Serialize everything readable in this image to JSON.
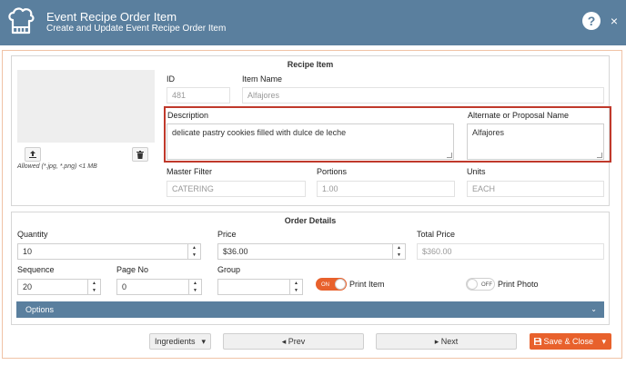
{
  "header": {
    "title": "Event Recipe Order Item",
    "subtitle": "Create and Update Event Recipe Order Item",
    "help_label": "?",
    "close_label": "×",
    "icon": "chef-hat-icon"
  },
  "recipe_item": {
    "section_title": "Recipe Item",
    "upload_icon": "upload-icon",
    "delete_icon": "trash-icon",
    "allowed_note": "Allowed (*.jpg, *.png) <1 MB",
    "id": {
      "label": "ID",
      "value": "481"
    },
    "item_name": {
      "label": "Item Name",
      "value": "Alfajores"
    },
    "description": {
      "label": "Description",
      "value": "delicate pastry cookies filled with dulce de leche"
    },
    "alternate_name": {
      "label": "Alternate or Proposal Name",
      "value": "Alfajores"
    },
    "master_filter": {
      "label": "Master Filter",
      "value": "CATERING"
    },
    "portions": {
      "label": "Portions",
      "value": "1.00"
    },
    "units": {
      "label": "Units",
      "value": "EACH"
    }
  },
  "order_details": {
    "section_title": "Order Details",
    "quantity": {
      "label": "Quantity",
      "value": "10"
    },
    "price": {
      "label": "Price",
      "value": "$36.00"
    },
    "total_price": {
      "label": "Total Price",
      "value": "$360.00"
    },
    "sequence": {
      "label": "Sequence",
      "value": "20"
    },
    "page_no": {
      "label": "Page No",
      "value": "0"
    },
    "group": {
      "label": "Group",
      "value": ""
    },
    "print_item": {
      "label": "Print Item",
      "state": "ON"
    },
    "print_photo": {
      "label": "Print Photo",
      "state": "OFF"
    },
    "spin_up": "▲",
    "spin_down": "▼"
  },
  "options": {
    "label": "Options",
    "chevron": "⌄"
  },
  "footer": {
    "ingredients_label": "Ingredients",
    "ingredients_caret": "▾",
    "prev_label": "◂  Prev",
    "next_label": "▸  Next",
    "save_label": "Save & Close",
    "save_caret": "▾"
  },
  "colors": {
    "header_bg": "#5a7f9e",
    "accent": "#e8612c",
    "highlight": "#c0392b"
  }
}
